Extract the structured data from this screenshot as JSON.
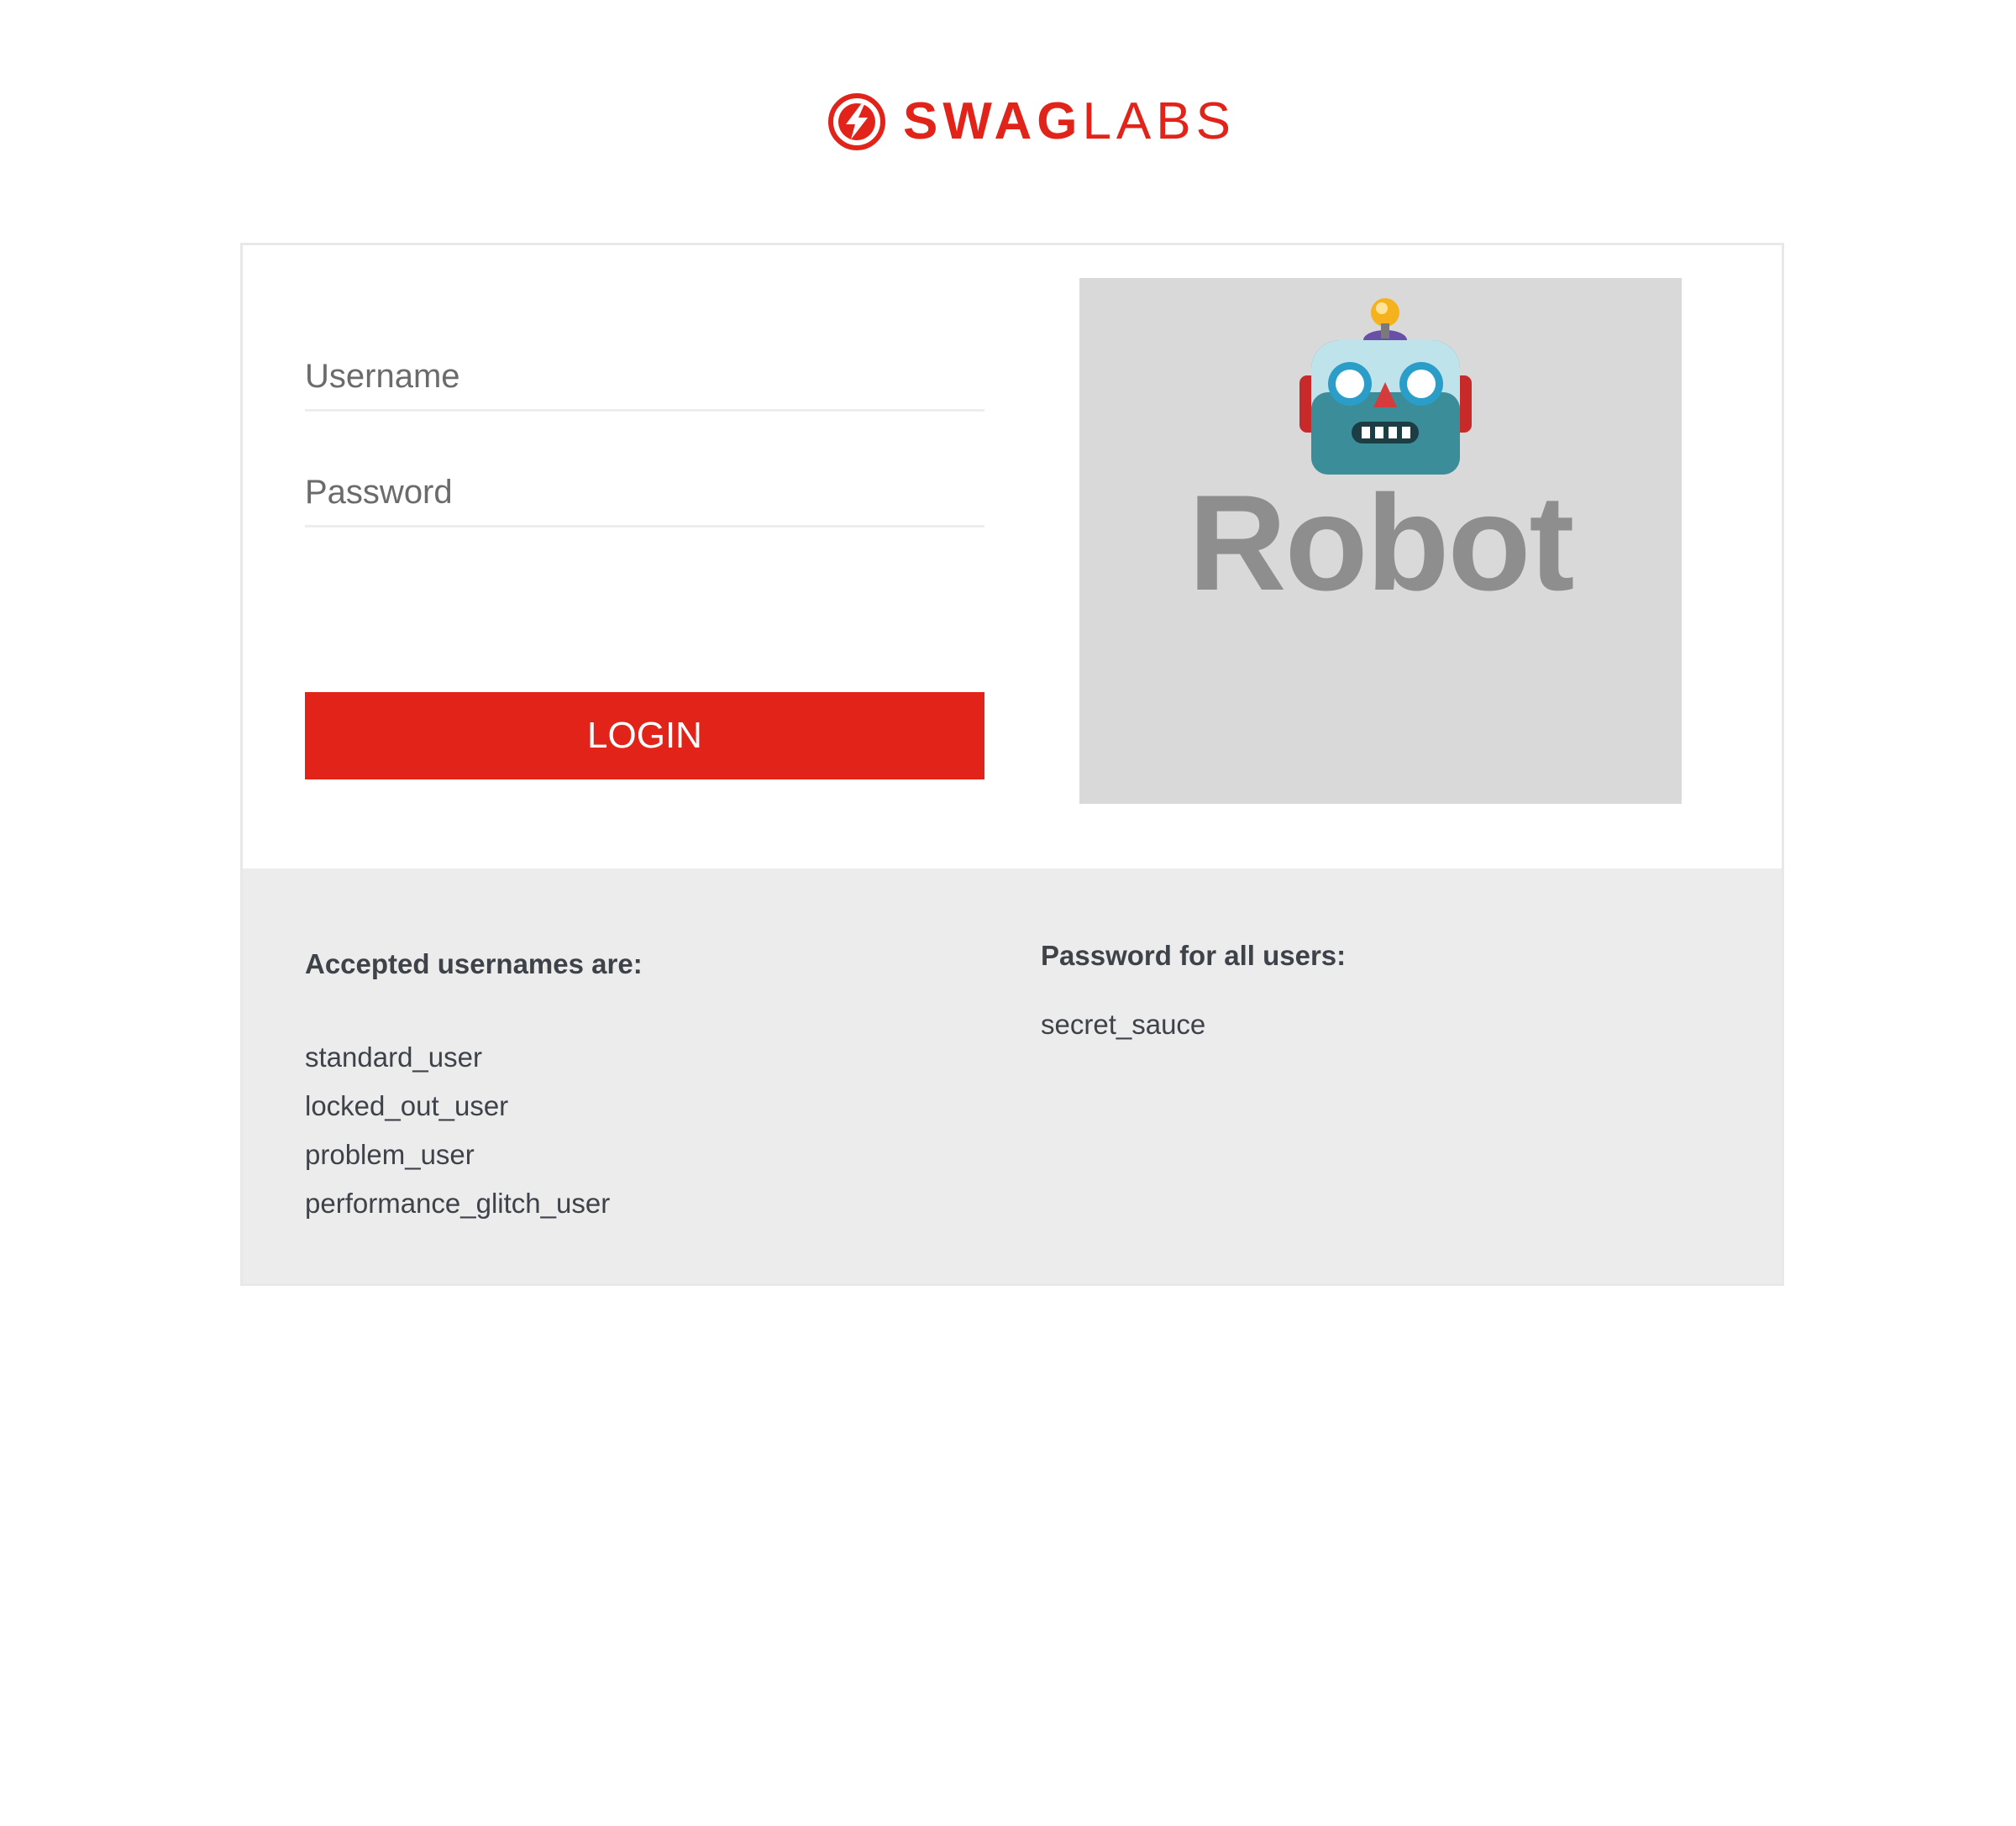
{
  "brand": {
    "name_bold": "SWAG",
    "name_light": "LABS",
    "accent_color": "#e2231a",
    "icon": "swag-labs-logo-icon"
  },
  "login_form": {
    "username_placeholder": "Username",
    "password_placeholder": "Password",
    "login_label": "LOGIN"
  },
  "bot_image": {
    "icon": "robot-face-icon",
    "caption": "Robot"
  },
  "credentials": {
    "usernames_heading": "Accepted usernames are:",
    "usernames": [
      "standard_user",
      "locked_out_user",
      "problem_user",
      "performance_glitch_user"
    ],
    "password_heading": "Password for all users:",
    "password": "secret_sauce"
  }
}
